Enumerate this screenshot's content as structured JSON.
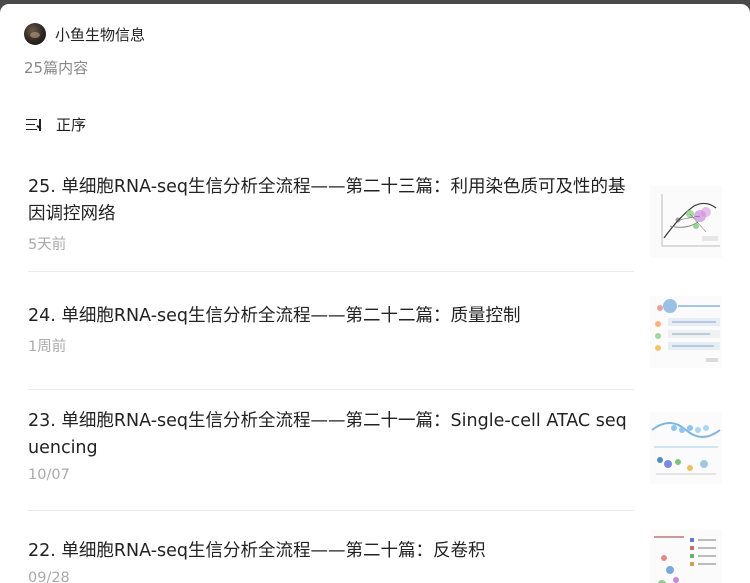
{
  "account": {
    "name": "小鱼生物信息"
  },
  "content_count": "25篇内容",
  "sort": {
    "label": "正序"
  },
  "articles": [
    {
      "title": "25. 单细胞RNA-seq生信分析全流程——第二十三篇：利用染色质可及性的基因调控网络",
      "date": "5天前"
    },
    {
      "title": "24. 单细胞RNA-seq生信分析全流程——第二十二篇：质量控制",
      "date": "1周前"
    },
    {
      "title": "23. 单细胞RNA-seq生信分析全流程——第二十一篇：Single-cell ATAC sequencing",
      "date": "10/07"
    },
    {
      "title": "22. 单细胞RNA-seq生信分析全流程——第二十篇：反卷积",
      "date": "09/28"
    }
  ]
}
